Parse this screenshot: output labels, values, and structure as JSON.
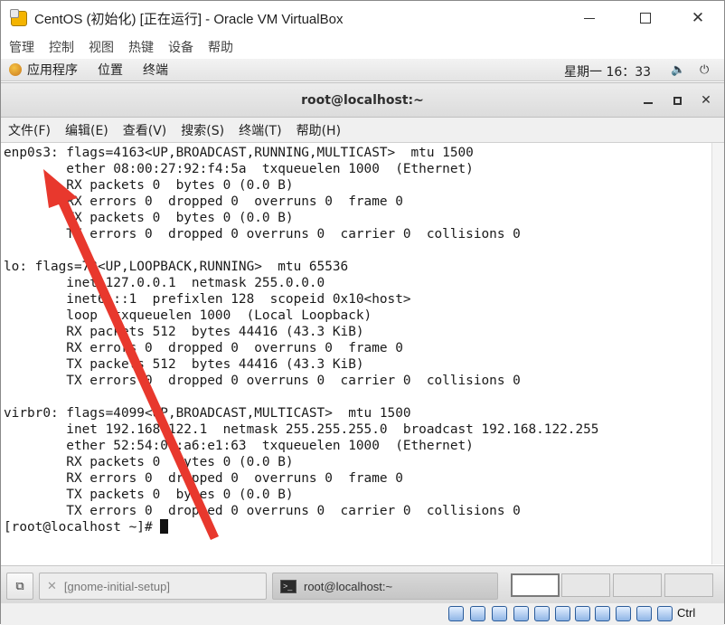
{
  "host_window": {
    "title": "CentOS (初始化) [正在运行] - Oracle VM VirtualBox",
    "menu": [
      "管理",
      "控制",
      "视图",
      "热键",
      "设备",
      "帮助"
    ]
  },
  "guest_panel": {
    "items": [
      "应用程序",
      "位置",
      "终端"
    ],
    "clock": "星期一 16：33"
  },
  "terminal": {
    "title": "root@localhost:~",
    "menu": [
      "文件(F)",
      "编辑(E)",
      "查看(V)",
      "搜索(S)",
      "终端(T)",
      "帮助(H)"
    ],
    "output": "enp0s3: flags=4163<UP,BROADCAST,RUNNING,MULTICAST>  mtu 1500\n        ether 08:00:27:92:f4:5a  txqueuelen 1000  (Ethernet)\n        RX packets 0  bytes 0 (0.0 B)\n        RX errors 0  dropped 0  overruns 0  frame 0\n        TX packets 0  bytes 0 (0.0 B)\n        TX errors 0  dropped 0 overruns 0  carrier 0  collisions 0\n\nlo: flags=73<UP,LOOPBACK,RUNNING>  mtu 65536\n        inet 127.0.0.1  netmask 255.0.0.0\n        inet6 ::1  prefixlen 128  scopeid 0x10<host>\n        loop  txqueuelen 1000  (Local Loopback)\n        RX packets 512  bytes 44416 (43.3 KiB)\n        RX errors 0  dropped 0  overruns 0  frame 0\n        TX packets 512  bytes 44416 (43.3 KiB)\n        TX errors 0  dropped 0 overruns 0  carrier 0  collisions 0\n\nvirbr0: flags=4099<UP,BROADCAST,MULTICAST>  mtu 1500\n        inet 192.168.122.1  netmask 255.255.255.0  broadcast 192.168.122.255\n        ether 52:54:00:a6:e1:63  txqueuelen 1000  (Ethernet)\n        RX packets 0  bytes 0 (0.0 B)\n        RX errors 0  dropped 0  overruns 0  frame 0\n        TX packets 0  bytes 0 (0.0 B)\n        TX errors 0  dropped 0 overruns 0  carrier 0  collisions 0\n",
    "prompt": "[root@localhost ~]# "
  },
  "taskbar": {
    "tasks": [
      "[gnome-initial-setup]",
      "root@localhost:~"
    ]
  },
  "status_bar": {
    "host_key": "Ctrl"
  },
  "colors": {
    "annotation_arrow": "#e8382d"
  }
}
